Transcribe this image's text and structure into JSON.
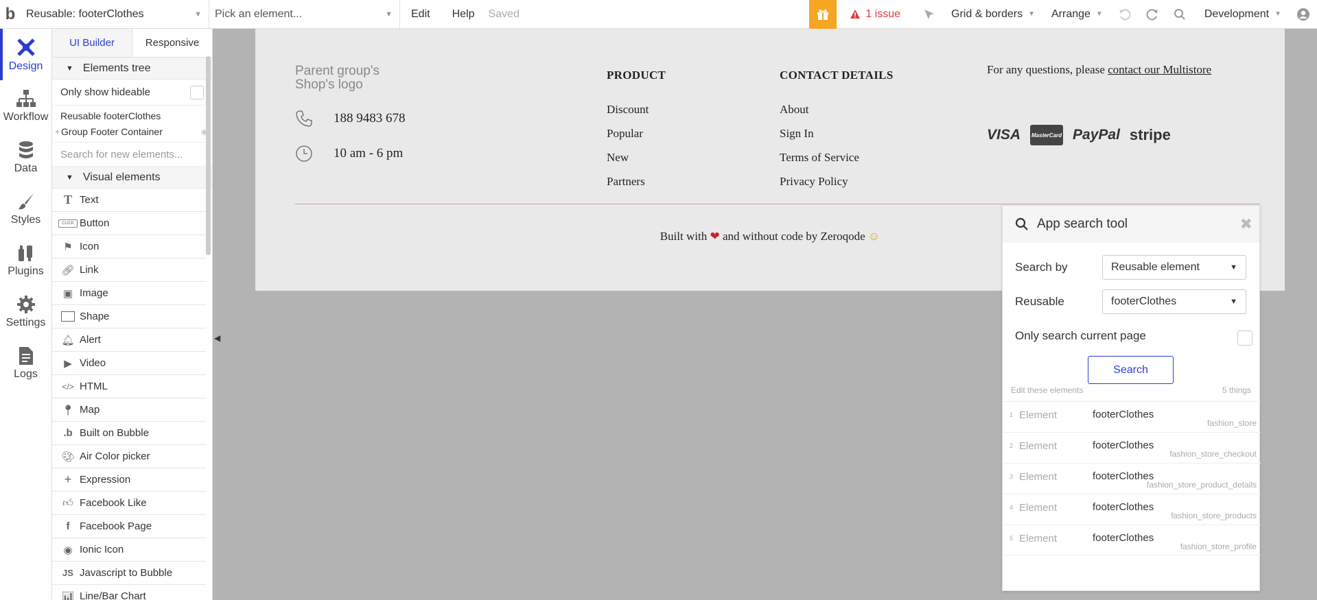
{
  "topbar": {
    "reusable_select": "Reusable: footerClothes",
    "element_picker_placeholder": "Pick an element...",
    "menu_edit": "Edit",
    "menu_help": "Help",
    "saved": "Saved",
    "issue": "1 issue",
    "grid_borders": "Grid & borders",
    "arrange": "Arrange",
    "environment": "Development"
  },
  "iconbar": [
    {
      "label": "Design",
      "icon": "design-icon"
    },
    {
      "label": "Workflow",
      "icon": "workflow-icon"
    },
    {
      "label": "Data",
      "icon": "data-icon"
    },
    {
      "label": "Styles",
      "icon": "styles-icon"
    },
    {
      "label": "Plugins",
      "icon": "plugins-icon"
    },
    {
      "label": "Settings",
      "icon": "settings-icon"
    },
    {
      "label": "Logs",
      "icon": "logs-icon"
    }
  ],
  "panel": {
    "tab_ui_builder": "UI Builder",
    "tab_responsive": "Responsive",
    "elements_tree": "Elements tree",
    "only_show_hideable": "Only show hideable",
    "tree": [
      "Reusable footerClothes",
      "Group Footer Container"
    ],
    "search_placeholder": "Search for new elements...",
    "visual_elements": "Visual elements",
    "elements": [
      {
        "label": "Text",
        "icon": "text-icon"
      },
      {
        "label": "Button",
        "icon": "button-icon"
      },
      {
        "label": "Icon",
        "icon": "flag-icon"
      },
      {
        "label": "Link",
        "icon": "link-icon"
      },
      {
        "label": "Image",
        "icon": "image-icon"
      },
      {
        "label": "Shape",
        "icon": "shape-icon"
      },
      {
        "label": "Alert",
        "icon": "bell-icon"
      },
      {
        "label": "Video",
        "icon": "video-icon"
      },
      {
        "label": "HTML",
        "icon": "code-icon"
      },
      {
        "label": "Map",
        "icon": "map-pin-icon"
      },
      {
        "label": "Built on Bubble",
        "icon": "bubble-icon"
      },
      {
        "label": "Air Color picker",
        "icon": "palette-icon"
      },
      {
        "label": "Expression",
        "icon": "plus-icon"
      },
      {
        "label": "Facebook Like",
        "icon": "thumbs-up-icon"
      },
      {
        "label": "Facebook Page",
        "icon": "facebook-icon"
      },
      {
        "label": "Ionic Icon",
        "icon": "ionic-icon"
      },
      {
        "label": "Javascript to Bubble",
        "icon": "js-icon"
      },
      {
        "label": "Line/Bar Chart",
        "icon": "chart-icon"
      }
    ]
  },
  "footer": {
    "logo": "Parent group's Shop's logo",
    "phone": "188 9483 678",
    "hours": "10 am - 6 pm",
    "product_title": "PRODUCT",
    "product_links": [
      "Discount",
      "Popular",
      "New",
      "Partners"
    ],
    "contact_title": "CONTACT DETAILS",
    "contact_links": [
      "About",
      "Sign In",
      "Terms of Service",
      "Privacy Policy"
    ],
    "question_prefix": "For any questions, please ",
    "question_link": "contact our Multistore",
    "payments": [
      "VISA",
      "MasterCard",
      "PayPal",
      "stripe"
    ],
    "built_prefix": "Built with",
    "built_suffix": "and without code by Zeroqode"
  },
  "search_tool": {
    "title": "App search tool",
    "search_by_label": "Search by",
    "search_by_value": "Reusable element",
    "reusable_label": "Reusable",
    "reusable_value": "footerClothes",
    "only_current_page": "Only search current page",
    "search_button": "Search",
    "edit_label": "Edit these elements",
    "count": "5 things",
    "results": [
      {
        "index": "1",
        "label": "Element",
        "name": "footerClothes",
        "page": "fashion_store"
      },
      {
        "index": "2",
        "label": "Element",
        "name": "footerClothes",
        "page": "fashion_store_checkout"
      },
      {
        "index": "3",
        "label": "Element",
        "name": "footerClothes",
        "page": "fashion_store_product_details"
      },
      {
        "index": "4",
        "label": "Element",
        "name": "footerClothes",
        "page": "fashion_store_products"
      },
      {
        "index": "5",
        "label": "Element",
        "name": "footerClothes",
        "page": "fashion_store_profile"
      }
    ]
  },
  "colors": {
    "accent": "#2c3ecf",
    "issue": "#e03a3a",
    "gift": "#f5a623"
  }
}
